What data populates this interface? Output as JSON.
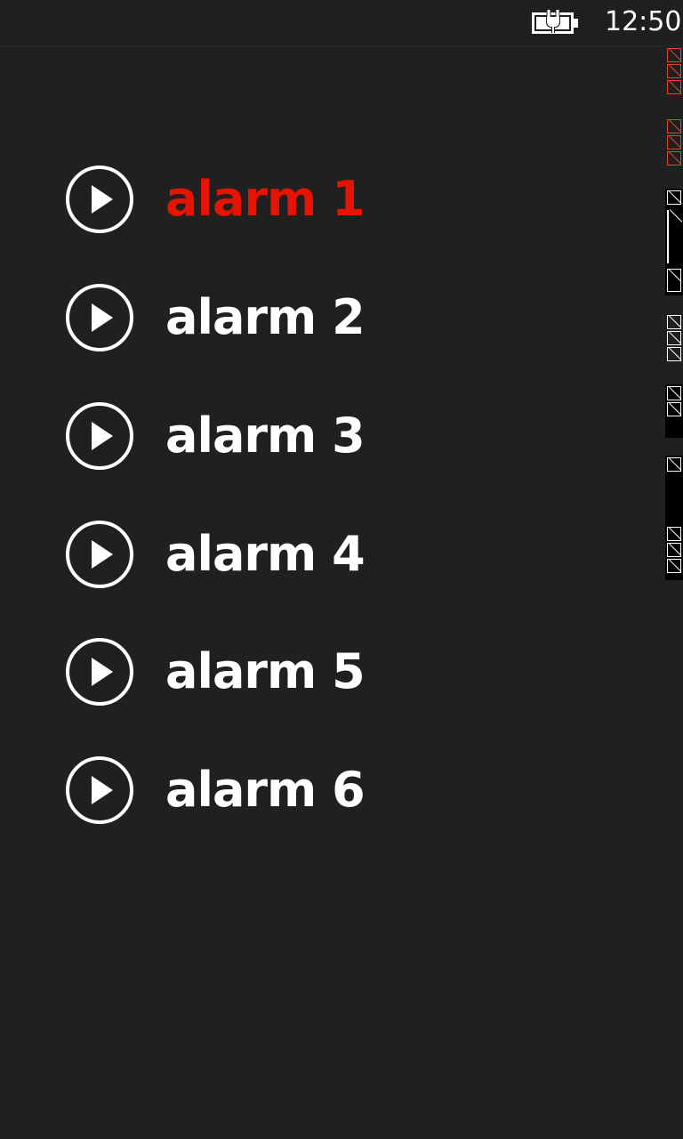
{
  "status_bar": {
    "time": "12:50",
    "battery_icon": "battery-charging-icon"
  },
  "alarms": [
    {
      "label": "alarm 1",
      "icon": "play-circle-icon",
      "active": true
    },
    {
      "label": "alarm 2",
      "icon": "play-circle-icon",
      "active": false
    },
    {
      "label": "alarm 3",
      "icon": "play-circle-icon",
      "active": false
    },
    {
      "label": "alarm 4",
      "icon": "play-circle-icon",
      "active": false
    },
    {
      "label": "alarm 5",
      "icon": "play-circle-icon",
      "active": false
    },
    {
      "label": "alarm 6",
      "icon": "play-circle-icon",
      "active": false
    }
  ],
  "colors": {
    "background": "#202020",
    "active_accent": "#e51400",
    "text": "#ffffff"
  }
}
